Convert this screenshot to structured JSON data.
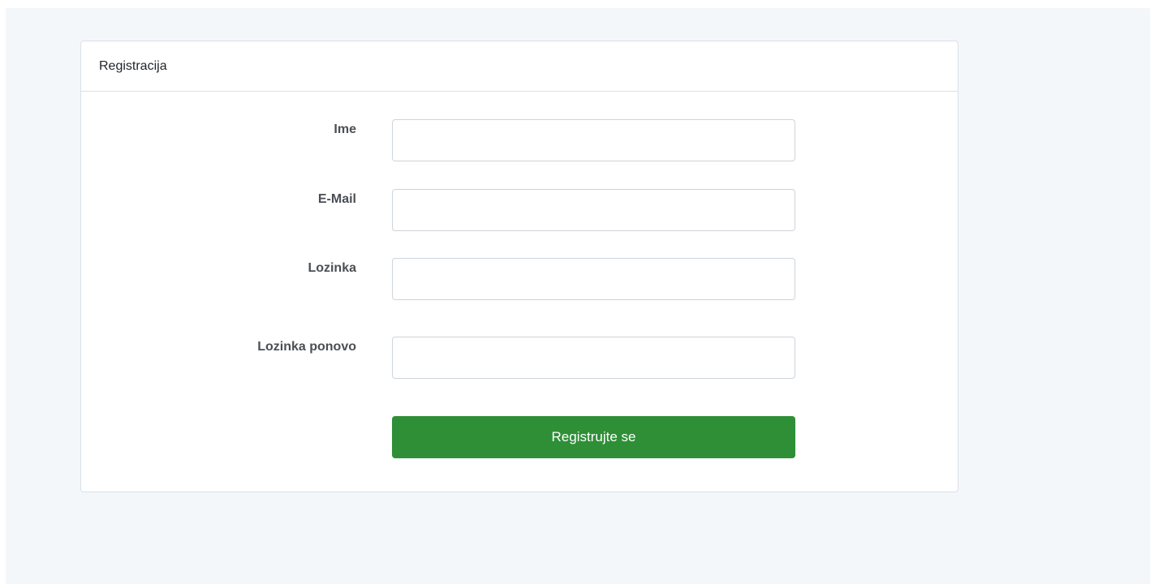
{
  "card": {
    "title": "Registracija"
  },
  "form": {
    "fields": [
      {
        "label": "Ime",
        "value": "",
        "type": "text"
      },
      {
        "label": "E-Mail",
        "value": "",
        "type": "email"
      },
      {
        "label": "Lozinka",
        "value": "",
        "type": "password"
      },
      {
        "label": "Lozinka ponovo",
        "value": "",
        "type": "password"
      }
    ],
    "submit_label": "Registrujte se"
  },
  "colors": {
    "page_background": "#f4f7fa",
    "submit_button": "#2e8f37"
  }
}
